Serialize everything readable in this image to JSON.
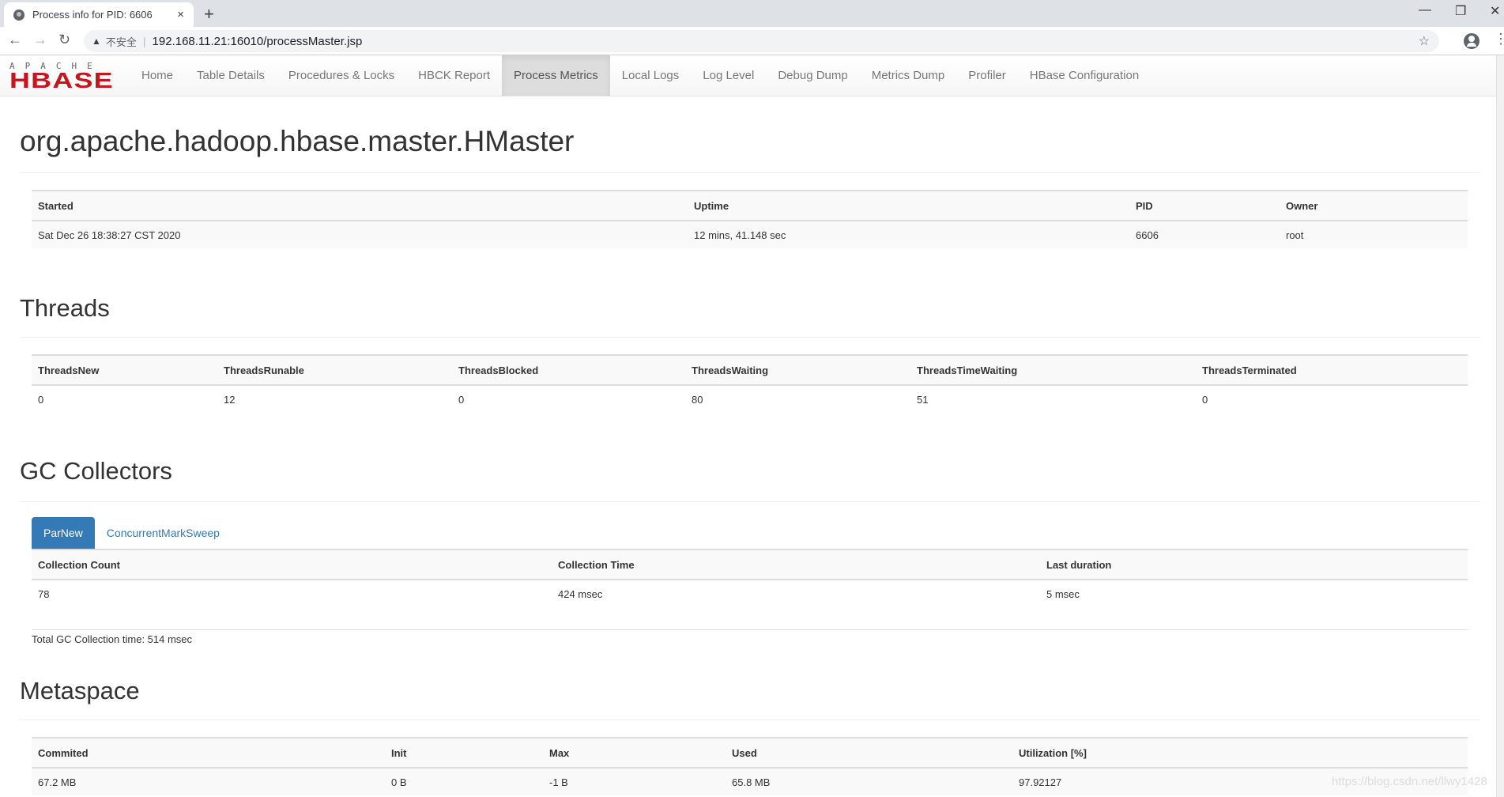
{
  "browser": {
    "tab_title": "Process info for PID: 6606",
    "tab_close": "×",
    "new_tab": "+",
    "window_controls": {
      "minimize": "—",
      "restore": "❐",
      "close": "✕"
    },
    "nav": {
      "back": "←",
      "forward": "→",
      "reload": "↻"
    },
    "security_icon": "▲",
    "security_label": "不安全",
    "separator": "|",
    "url": "192.168.11.21:16010/processMaster.jsp",
    "bookmark_icon": "☆",
    "menu_icon": "⋮"
  },
  "app": {
    "logo": {
      "top": "APACHE",
      "bottom": "HBASE"
    },
    "nav": [
      {
        "label": "Home",
        "active": false
      },
      {
        "label": "Table Details",
        "active": false
      },
      {
        "label": "Procedures & Locks",
        "active": false
      },
      {
        "label": "HBCK Report",
        "active": false
      },
      {
        "label": "Process Metrics",
        "active": true
      },
      {
        "label": "Local Logs",
        "active": false
      },
      {
        "label": "Log Level",
        "active": false
      },
      {
        "label": "Debug Dump",
        "active": false
      },
      {
        "label": "Metrics Dump",
        "active": false
      },
      {
        "label": "Profiler",
        "active": false
      },
      {
        "label": "HBase Configuration",
        "active": false
      }
    ]
  },
  "page": {
    "title": "org.apache.hadoop.hbase.master.HMaster",
    "process": {
      "headers": [
        "Started",
        "Uptime",
        "PID",
        "Owner"
      ],
      "row": [
        "Sat Dec 26 18:38:27 CST 2020",
        "12 mins, 41.148 sec",
        "6606",
        "root"
      ]
    },
    "threads": {
      "heading": "Threads",
      "headers": [
        "ThreadsNew",
        "ThreadsRunable",
        "ThreadsBlocked",
        "ThreadsWaiting",
        "ThreadsTimeWaiting",
        "ThreadsTerminated"
      ],
      "row": [
        "0",
        "12",
        "0",
        "80",
        "51",
        "0"
      ]
    },
    "gc": {
      "heading": "GC Collectors",
      "tabs": [
        {
          "label": "ParNew",
          "active": true
        },
        {
          "label": "ConcurrentMarkSweep",
          "active": false
        }
      ],
      "headers": [
        "Collection Count",
        "Collection Time",
        "Last duration"
      ],
      "row": [
        "78",
        "424 msec",
        "5 msec"
      ],
      "total": "Total GC Collection time: 514 msec"
    },
    "metaspace": {
      "heading": "Metaspace",
      "headers": [
        "Commited",
        "Init",
        "Max",
        "Used",
        "Utilization [%]"
      ],
      "row": [
        "67.2 MB",
        "0 B",
        "-1 B",
        "65.8 MB",
        "97.92127"
      ]
    }
  },
  "watermark": "https://blog.csdn.net/llwy1428"
}
